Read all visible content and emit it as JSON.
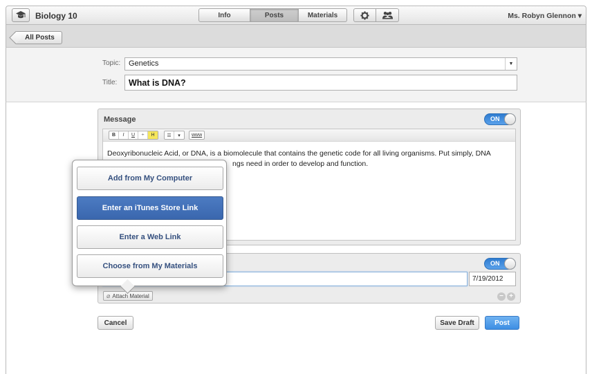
{
  "header": {
    "course_title": "Biology 10",
    "course_icon": "graduation-cap-icon",
    "tabs": [
      {
        "label": "Info",
        "active": false
      },
      {
        "label": "Posts",
        "active": true
      },
      {
        "label": "Materials",
        "active": false
      }
    ],
    "settings_icon": "gear-icon",
    "people_icon": "people-icon",
    "user_name": "Ms. Robyn Glennon ▾"
  },
  "subbar": {
    "back_label": "All Posts"
  },
  "post": {
    "topic_label": "Topic:",
    "topic_value": "Genetics",
    "title_label": "Title:",
    "title_value": "What is DNA?"
  },
  "message": {
    "label": "Message",
    "toggle": "ON",
    "toolbar": [
      "B",
      "I",
      "U",
      "÷",
      "H",
      "☰",
      "▾",
      "www"
    ],
    "body": "Deoxyribonucleic Acid, or DNA, is a biomolecule that contains the genetic code for all living organisms. Put simply, DNA [...] ngs need in order to develop and function.",
    "body_line1": "Deoxyribonucleic Acid, or DNA, is a biomolecule that contains the genetic code for all living organisms. Put simply, DNA",
    "body_line2_visible": "ngs need in order to develop and function."
  },
  "materials": {
    "toggle": "ON",
    "date": "7/19/2012",
    "attach_label": "Attach Material",
    "remove_icon": "minus-circle-icon",
    "add_icon": "plus-circle-icon"
  },
  "actions": {
    "cancel": "Cancel",
    "save_draft": "Save Draft",
    "post": "Post"
  },
  "popover": {
    "options": [
      {
        "label": "Add from My Computer",
        "selected": false
      },
      {
        "label": "Enter an iTunes Store Link",
        "selected": true
      },
      {
        "label": "Enter a Web Link",
        "selected": false
      },
      {
        "label": "Choose from My Materials",
        "selected": false
      }
    ]
  },
  "colors": {
    "accent_blue": "#3d8ee3",
    "selected_option": "#4170b8",
    "toggle_on": "#3a88dc"
  }
}
